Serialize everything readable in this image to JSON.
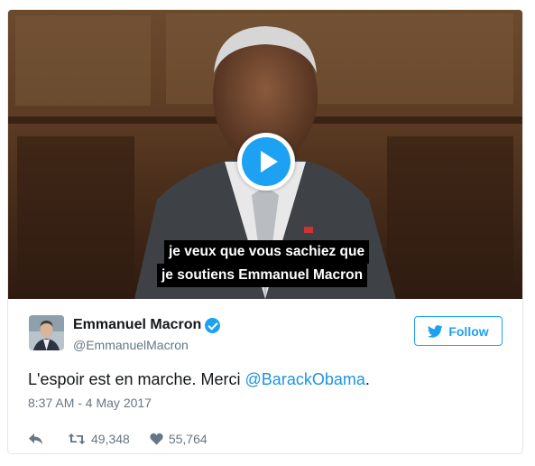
{
  "video": {
    "subtitle_line1": "je veux que vous sachiez que",
    "subtitle_line2": "je soutiens Emmanuel Macron"
  },
  "tweet": {
    "name": "Emmanuel Macron",
    "handle": "@EmmanuelMacron",
    "follow_label": "Follow",
    "text_prefix": "L'espoir est en marche. Merci ",
    "mention": "@BarackObama",
    "text_suffix": ".",
    "timestamp": "8:37 AM - 4 May 2017",
    "retweet_count": "49,348",
    "like_count": "55,764"
  },
  "colors": {
    "accent": "#1da1f2",
    "mention": "#1b95e0",
    "meta": "#657786",
    "text": "#14171a"
  },
  "icons": {
    "play": "play-icon",
    "verified": "verified-badge-icon",
    "bird": "twitter-bird-icon",
    "reply": "reply-icon",
    "retweet": "retweet-icon",
    "like": "heart-icon"
  }
}
